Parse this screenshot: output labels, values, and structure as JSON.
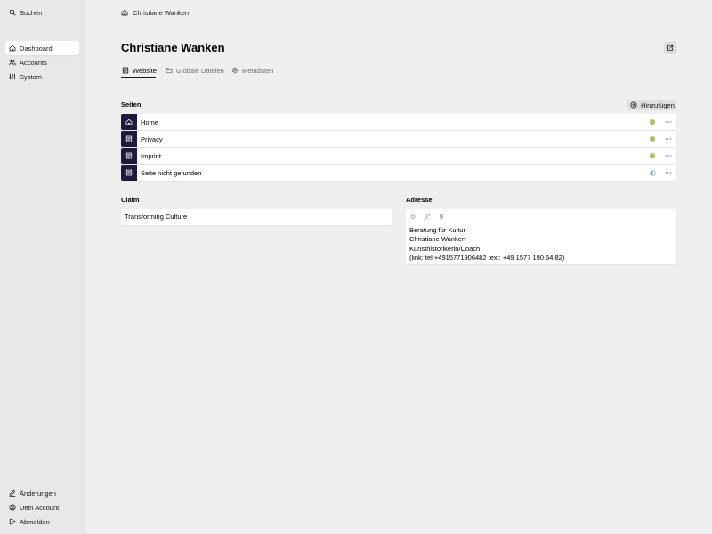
{
  "colors": {
    "sidebar_bg": "#e8e8e8",
    "page_icon_bg": "#1b1b3a",
    "status_listed": "#a6c65c",
    "status_unlisted": "#7da4d9",
    "ink": "#16171a"
  },
  "sidebar": {
    "search": {
      "label": "Suchen",
      "icon": "search-icon"
    },
    "menu": [
      {
        "label": "Dashboard",
        "icon": "home-icon",
        "active": true
      },
      {
        "label": "Accounts",
        "icon": "users-icon",
        "active": false
      },
      {
        "label": "System",
        "icon": "sliders-icon",
        "active": false
      }
    ],
    "footer": [
      {
        "label": "Änderungen",
        "icon": "edit-icon"
      },
      {
        "label": "Dein Account",
        "icon": "user-circle-icon"
      },
      {
        "label": "Abmelden",
        "icon": "logout-icon"
      }
    ]
  },
  "breadcrumb": {
    "icon": "home-icon",
    "items": [
      "Christiane Wanken"
    ]
  },
  "header": {
    "title": "Christiane Wanken",
    "open_icon": "open-icon"
  },
  "tabs": [
    {
      "label": "Website",
      "icon": "page-icon",
      "active": true
    },
    {
      "label": "Globale Dateien",
      "icon": "folder-icon",
      "active": false
    },
    {
      "label": "Metadaten",
      "icon": "gear-icon",
      "active": false
    }
  ],
  "pages_section": {
    "label": "Seiten",
    "add_label": "Hinzufügen",
    "add_icon": "add-icon",
    "items": [
      {
        "title": "Home",
        "icon": "home-icon",
        "status_icon": "status-listed-icon"
      },
      {
        "title": "Privacy",
        "icon": "page-icon",
        "status_icon": "status-listed-icon"
      },
      {
        "title": "Imprint",
        "icon": "page-icon",
        "status_icon": "status-listed-icon"
      },
      {
        "title": "Seite nicht gefunden",
        "icon": "page-icon",
        "status_icon": "status-unlisted-icon"
      }
    ],
    "options_icon": "dots-icon"
  },
  "claim": {
    "label": "Claim",
    "value": "Transforming Culture"
  },
  "address": {
    "label": "Adresse",
    "toolbar": [
      "bold-icon",
      "link-icon",
      "attachment-icon"
    ],
    "lines": [
      "Beratung für Kultur",
      "Christiane Wanken",
      "Kunsthistorikerin/Coach",
      "(link: tel:+4915771906482 text: +49 1577 190 64 82)"
    ]
  }
}
